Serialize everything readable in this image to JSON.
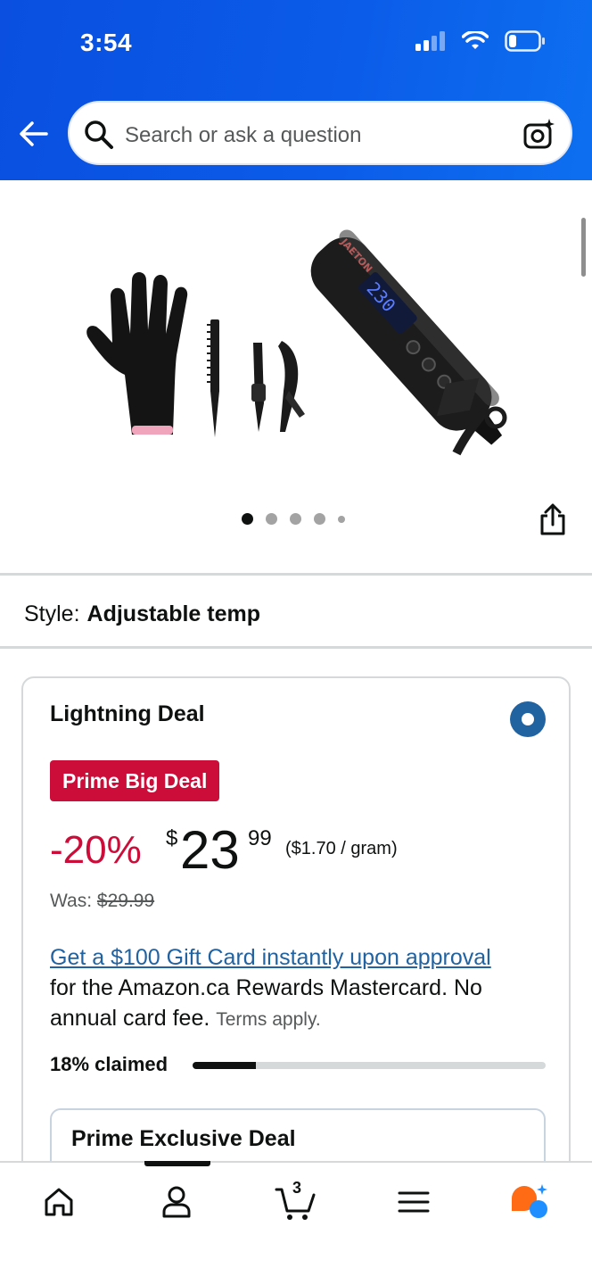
{
  "status_bar": {
    "time": "3:54"
  },
  "search": {
    "placeholder": "Search or ask a question"
  },
  "icons": {
    "back": "arrow-left-icon",
    "search": "magnifier-icon",
    "camera": "camera-lens-icon",
    "share": "share-icon",
    "home": "home-icon",
    "account": "person-icon",
    "cart": "cart-icon",
    "menu": "hamburger-icon",
    "assistant": "rufus-icon"
  },
  "product_image": {
    "brand_mark": "JAETON",
    "display_value": "230",
    "carousel": {
      "total": 5,
      "active_index": 0
    }
  },
  "style": {
    "label": "Style:",
    "value": "Adjustable temp"
  },
  "deal": {
    "title": "Lightning Deal",
    "badge": "Prime Big Deal",
    "discount": "-20%",
    "currency": "$",
    "price_whole": "23",
    "price_fraction": "99",
    "unit_price": "($1.70 / gram)",
    "was_label": "Was:",
    "was_price": "$29.99",
    "promo_link": "Get a $100 Gift Card instantly upon approval",
    "promo_text": "for the Amazon.ca Rewards Mastercard. No annual card fee.",
    "terms": "Terms apply.",
    "claimed_label": "18% claimed",
    "claimed_fraction": 0.18,
    "sub_card_title": "Prime Exclusive Deal"
  },
  "bottom_nav": {
    "cart_count": "3"
  },
  "colors": {
    "header_blue": "#0b5be8",
    "deal_red": "#cc0c39",
    "link_blue": "#2162a1",
    "radio_blue": "#2162a1",
    "assistant_orange": "#ff6a14",
    "assistant_blue": "#1f8fff"
  }
}
